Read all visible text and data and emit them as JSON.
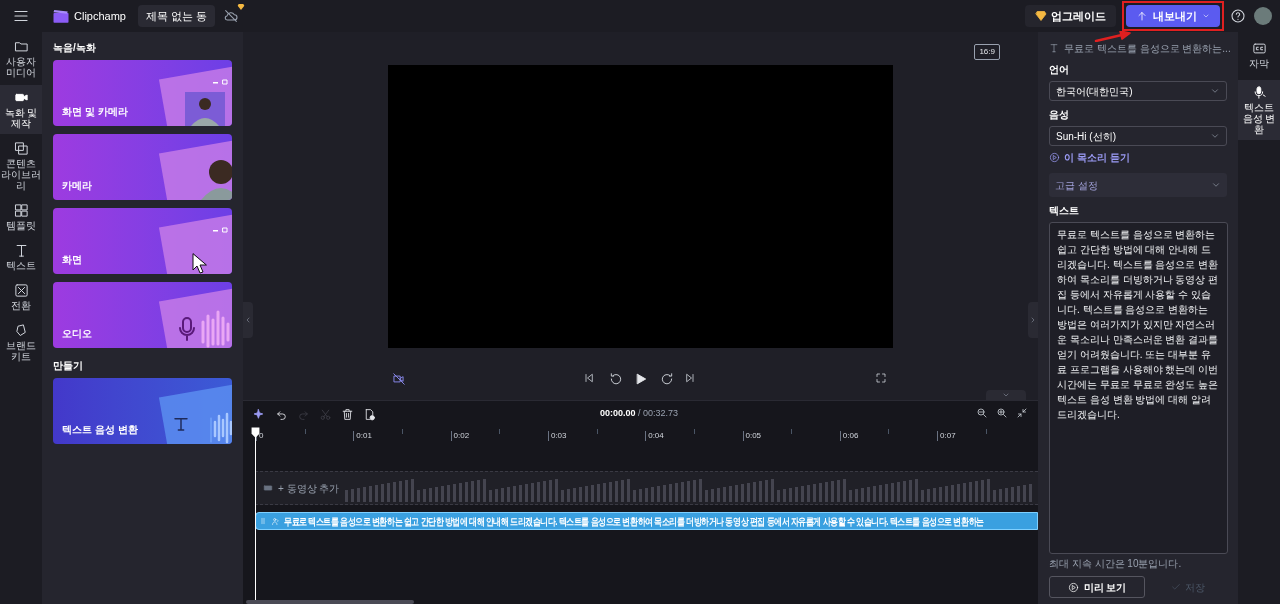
{
  "topbar": {
    "logo_text": "Clipchamp",
    "project_title": "제목 없는 동",
    "upgrade_label": "업그레이드",
    "export_label": "내보내기"
  },
  "left_rail": [
    {
      "label": "사용자 미디어",
      "kind": "folder",
      "selected": false
    },
    {
      "label": "녹화 및 제작",
      "kind": "camera",
      "selected": true
    },
    {
      "label": "콘텐츠 라이브러리",
      "kind": "library",
      "selected": false
    },
    {
      "label": "템플릿",
      "kind": "templates",
      "selected": false
    },
    {
      "label": "텍스트",
      "kind": "text",
      "selected": false
    },
    {
      "label": "전환",
      "kind": "transition",
      "selected": false
    },
    {
      "label": "브랜드 키트",
      "kind": "brand",
      "selected": false
    }
  ],
  "panel": {
    "sections": [
      {
        "heading": "녹음/녹화",
        "cards": [
          {
            "label": "화면 및 카메라",
            "kind": "screen_camera"
          },
          {
            "label": "카메라",
            "kind": "camera"
          },
          {
            "label": "화면",
            "kind": "screen"
          },
          {
            "label": "오디오",
            "kind": "audio"
          }
        ]
      },
      {
        "heading": "만들기",
        "cards": [
          {
            "label": "텍스트 음성 변환",
            "kind": "tts"
          }
        ]
      }
    ]
  },
  "preview": {
    "aspect_ratio": "16:9"
  },
  "timeline": {
    "tools": [
      {
        "kind": "magic",
        "disabled": false
      },
      {
        "kind": "undo",
        "disabled": false
      },
      {
        "kind": "redo",
        "disabled": true
      },
      {
        "kind": "cut",
        "disabled": true
      },
      {
        "kind": "delete",
        "disabled": false
      },
      {
        "kind": "add",
        "disabled": false
      }
    ],
    "current_time": "00:00.00",
    "total_time": "/ 00:32.73",
    "ruler": [
      "0",
      "0:01",
      "0:02",
      "0:03",
      "0:04",
      "0:05",
      "0:06",
      "0:07"
    ],
    "video_track_hint": "+ 동영상 추가",
    "audio_clip": "무료로 텍스트를 음성으로 변환하는 쉽고 간단한 방법에 대해 안내해 드리겠습니다. 텍스트를 음성으로 변환하여 목소리를 더빙하거나 동영상 편집 등에서 자유롭게 사용할 수 있습니다. 텍스트를 음성으로 변환하는"
  },
  "tts_panel": {
    "title": "무료로 텍스트를 음성으로 변환하는...",
    "language_label": "언어",
    "language": "한국어(대한민국)",
    "voice_label": "음성",
    "voice": "Sun-Hi (선히)",
    "listen_link": "이 목소리 듣기",
    "advanced": {
      "label": "고급 설정",
      "expanded": false
    },
    "text_label": "텍스트",
    "text": "무료로 텍스트를 음성으로 변환하는 쉽고 간단한 방법에 대해 안내해 드리겠습니다. 텍스트를 음성으로 변환하여 목소리를 더빙하거나 동영상 편집 등에서 자유롭게 사용할 수 있습니다. 텍스트를 음성으로 변환하는 방법은 여러가지가 있지만 자연스러운 목소리나 만족스러운 변환 결과를 얻기 어려웠습니다. 또는 대부분 유료 프로그램을 사용해야 했는데 이번 시간에는 무료로 무료로 완성도 높은 텍스트 음성 변환 방법에 대해 알려드리겠습니다.",
    "limit_note": "최대 지속 시간은 10분입니다.",
    "preview_button": "미리 보기",
    "save": {
      "label": "저장",
      "disabled": true
    }
  },
  "right_rail": [
    {
      "label": "자막",
      "kind": "captions",
      "selected": false
    },
    {
      "label": "텍스트 음성 변환",
      "kind": "tts",
      "selected": true
    }
  ]
}
